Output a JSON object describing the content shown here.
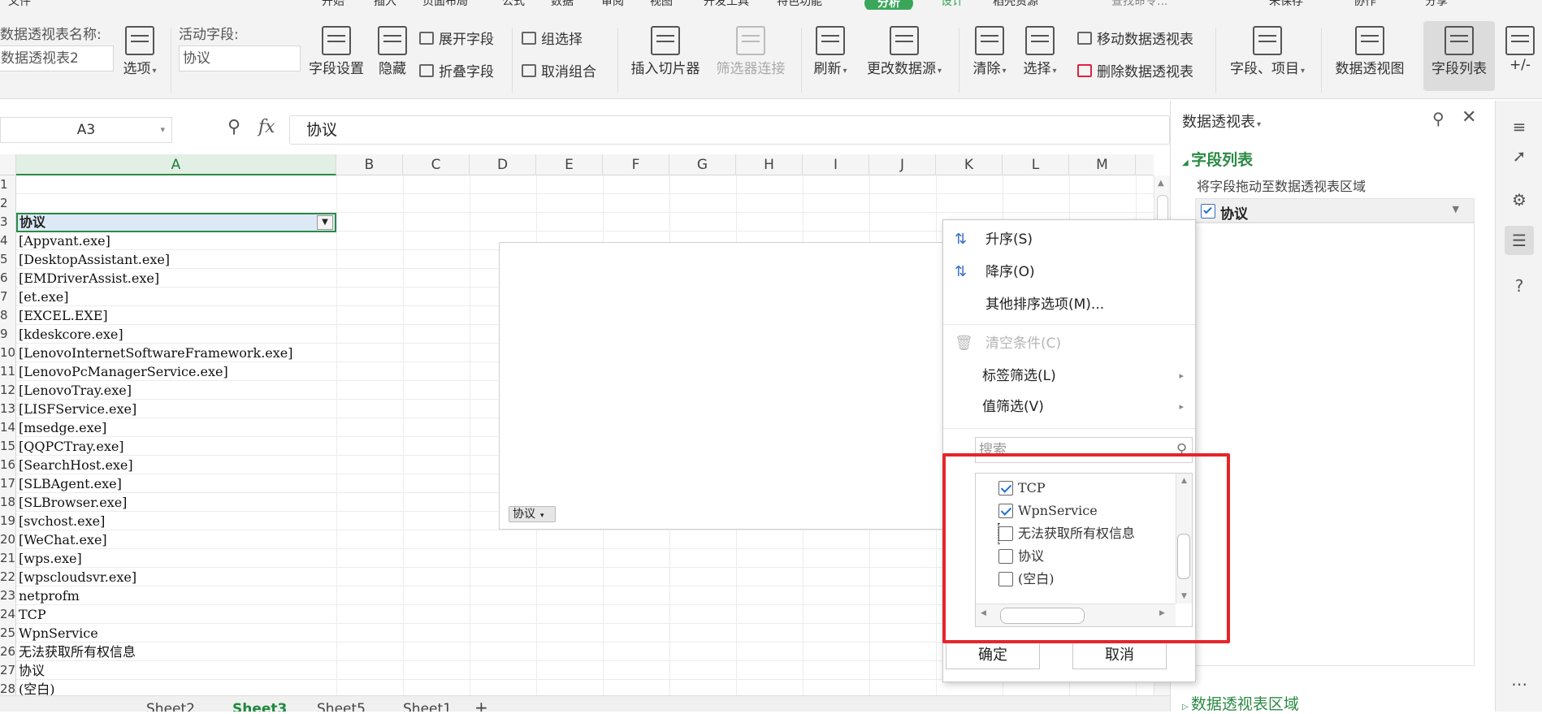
{
  "top_tabs": [
    "文件",
    "开始",
    "插入",
    "页面布局",
    "公式",
    "数据",
    "审阅",
    "视图",
    "开发工具",
    "特色功能",
    "分析",
    "设计",
    "稻壳资源",
    "查找命令...",
    "未保存",
    "协作",
    "分享"
  ],
  "active_top_tab": "分析",
  "ribbon": {
    "pivot_name_label": "数据透视表名称:",
    "pivot_name_value": "数据透视表2",
    "options_label": "选项",
    "active_field_label": "活动字段:",
    "active_field_value": "协议",
    "field_settings": "字段设置",
    "hide": "隐藏",
    "expand_field": "展开字段",
    "collapse_field": "折叠字段",
    "group_selection": "组选择",
    "ungroup": "取消组合",
    "insert_slicer": "插入切片器",
    "filter_connections": "筛选器连接",
    "refresh": "刷新",
    "change_source": "更改数据源",
    "clear": "清除",
    "select": "选择",
    "move_pivot": "移动数据透视表",
    "delete_pivot": "删除数据透视表",
    "fields_items": "字段、项目",
    "pivot_chart": "数据透视图",
    "field_list": "字段列表",
    "plus_minus": "+/-"
  },
  "formula_bar": {
    "name_box": "A3",
    "fx": "fx",
    "value": "协议"
  },
  "columns": [
    "A",
    "B",
    "C",
    "D",
    "E",
    "F",
    "G",
    "H",
    "I",
    "J",
    "K",
    "L",
    "M"
  ],
  "rows": [
    {
      "num": "1",
      "text": ""
    },
    {
      "num": "2",
      "text": ""
    },
    {
      "num": "3",
      "text": "协议"
    },
    {
      "num": "4",
      "text": "[Appvant.exe]"
    },
    {
      "num": "5",
      "text": "[DesktopAssistant.exe]"
    },
    {
      "num": "6",
      "text": "[EMDriverAssist.exe]"
    },
    {
      "num": "7",
      "text": "[et.exe]"
    },
    {
      "num": "8",
      "text": "[EXCEL.EXE]"
    },
    {
      "num": "9",
      "text": "[kdeskcore.exe]"
    },
    {
      "num": "10",
      "text": "[LenovoInternetSoftwareFramework.exe]"
    },
    {
      "num": "11",
      "text": "[LenovoPcManagerService.exe]"
    },
    {
      "num": "12",
      "text": "[LenovoTray.exe]"
    },
    {
      "num": "13",
      "text": "[LISFService.exe]"
    },
    {
      "num": "14",
      "text": "[msedge.exe]"
    },
    {
      "num": "15",
      "text": "[QQPCTray.exe]"
    },
    {
      "num": "16",
      "text": "[SearchHost.exe]"
    },
    {
      "num": "17",
      "text": "[SLBAgent.exe]"
    },
    {
      "num": "18",
      "text": "[SLBrowser.exe]"
    },
    {
      "num": "19",
      "text": "[svchost.exe]"
    },
    {
      "num": "20",
      "text": "[WeChat.exe]"
    },
    {
      "num": "21",
      "text": "[wps.exe]"
    },
    {
      "num": "22",
      "text": "[wpscloudsvr.exe]"
    },
    {
      "num": "23",
      "text": "netprofm"
    },
    {
      "num": "24",
      "text": "TCP"
    },
    {
      "num": "25",
      "text": "WpnService"
    },
    {
      "num": "26",
      "text": "无法获取所有权信息"
    },
    {
      "num": "27",
      "text": "协议"
    },
    {
      "num": "28",
      "text": "(空白)"
    }
  ],
  "pivot_tag": "协议",
  "sheet_tabs": [
    "Sheet2",
    "Sheet3",
    "Sheet5",
    "Sheet1"
  ],
  "active_sheet": "Sheet3",
  "right_panel": {
    "title": "数据透视表",
    "field_list_heading": "字段列表",
    "hint": "将字段拖动至数据透视表区域",
    "field": "协议",
    "areas_heading": "数据透视表区域"
  },
  "dropdown": {
    "sort_asc": "升序(S)",
    "sort_desc": "降序(O)",
    "more_sort": "其他排序选项(M)...",
    "clear_condition": "清空条件(C)",
    "label_filter": "标签筛选(L)",
    "value_filter": "值筛选(V)",
    "search_placeholder": "搜索",
    "items": [
      {
        "label": "TCP",
        "checked": true
      },
      {
        "label": "WpnService",
        "checked": true
      },
      {
        "label": "无法获取所有权信息",
        "checked": false
      },
      {
        "label": "协议",
        "checked": false
      },
      {
        "label": "(空白)",
        "checked": false
      }
    ],
    "ok": "确定",
    "cancel": "取消"
  },
  "colors": {
    "accent_green": "#2c8a45",
    "highlight_red": "#e5252a",
    "checkbox_blue": "#1f6fd6"
  }
}
